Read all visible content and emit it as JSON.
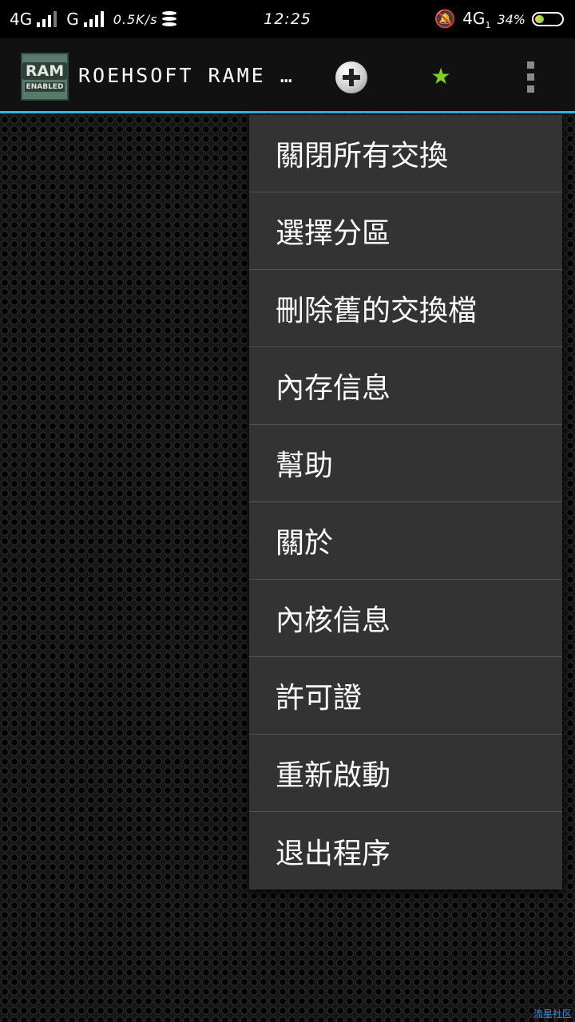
{
  "status_bar": {
    "network1": "4G",
    "network2": "G",
    "speed": "0.5K/s",
    "time": "12:25",
    "network3": "4G",
    "sim_index": "1",
    "battery_percent": "34%",
    "battery_level": 0.34
  },
  "app_bar": {
    "icon_text_top": "RAM",
    "icon_text_bottom": "ENABLED",
    "title": "ROEHSOFT RAME …"
  },
  "menu": {
    "items": [
      "關閉所有交換",
      "選擇分區",
      "刪除舊的交換檔",
      "內存信息",
      "幫助",
      "關於",
      "內核信息",
      "許可證",
      "重新啟動",
      "退出程序"
    ]
  },
  "watermark": "流星社区",
  "colors": {
    "accent_line": "#33b5e5",
    "star": "#7ed321",
    "menu_bg": "#333333"
  }
}
